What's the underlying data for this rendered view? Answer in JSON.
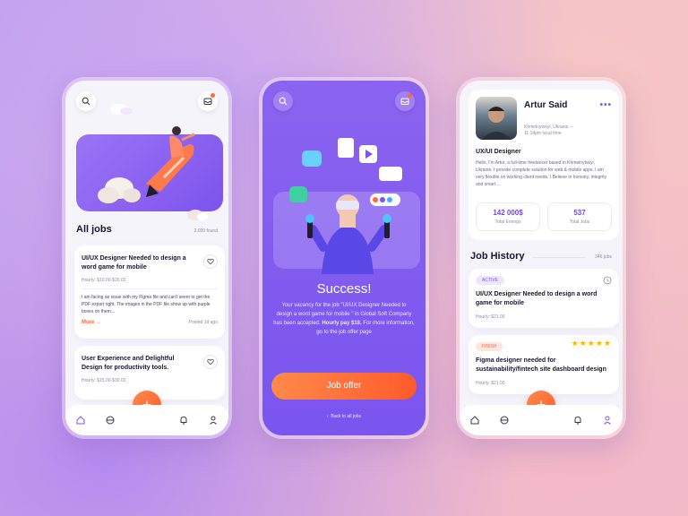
{
  "screen1": {
    "section_title": "All jobs",
    "count": "2.020 found",
    "jobs": [
      {
        "title": "UI/UX Designer Needed to design a word game for mobile",
        "rate": "Hourly: $10.00-$20.00",
        "description": "I am facing an issue with my Figma file and can't seem to get the PDF export right. The images in the PDF file show up with purple boxes on them...",
        "more": "More",
        "posted": "Posted 1d ago"
      },
      {
        "title": "User Experience and Delightful Design for productivity tools.",
        "rate": "Hourly: $15.00-$30.00"
      }
    ]
  },
  "screen2": {
    "title": "Success!",
    "message_prefix": "Your vacancy for the job \"UI/UX Designer Needed to design a word game for mobile \" in Global Soft Company has been accepted.",
    "message_bold": "Hourly pay $18.",
    "message_suffix": "For more information, go to the job offer page",
    "button": "Job offer",
    "back": "Back to all jobs"
  },
  "screen3": {
    "name": "Artur Said",
    "location": "Khmelnytskyi, Ukraine –",
    "local_time": "11:14pm local time",
    "role": "UX/UI Designer",
    "bio": "Hello, I'm Artur, a full-time freelancer based in Khmelnytskyi, Ukraine. I provide complete solution for web & mobile apps. I am very flexible on working client needs. I Believe in honesty, integrity and smart ...",
    "stats": [
      {
        "value": "142 000$",
        "label": "Total Ernings"
      },
      {
        "value": "537",
        "label": "Total Jobs"
      }
    ],
    "history_title": "Job History",
    "history_count": "346 jobs",
    "history": [
      {
        "badge": "ACTIVE",
        "title": "UI/UX Designer Needed to design a word game for mobile",
        "rate": "Hourly: $21.00"
      },
      {
        "badge": "FINISH",
        "title": "Figma designer needed for sustainability/fintech site dashboard design",
        "rate": "Hourly: $21.00",
        "rating": 5
      }
    ]
  },
  "colors": {
    "accent": "#7a55ee",
    "orange": "#ff6a3c",
    "active_badge_bg": "#ece6ff",
    "finish_badge_bg": "#ffe6dc"
  },
  "fab_label": "+"
}
